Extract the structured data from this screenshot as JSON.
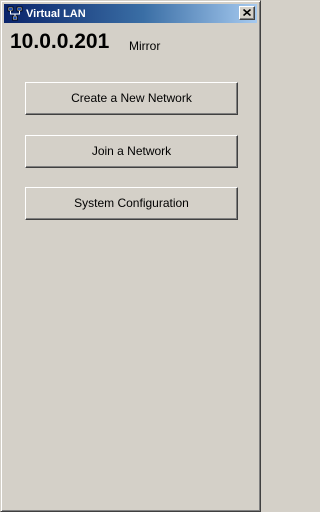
{
  "window": {
    "title": "Virtual LAN",
    "icon": "network-icon",
    "close_icon": "close-icon"
  },
  "status": {
    "ip_address": "10.0.0.201",
    "mode": "Mirror"
  },
  "actions": {
    "create_network": "Create a New Network",
    "join_network": "Join a Network",
    "system_configuration": "System Configuration"
  },
  "colors": {
    "face": "#d4d0c8",
    "titlebar_start": "#0a246a",
    "titlebar_end": "#a6caf0"
  }
}
